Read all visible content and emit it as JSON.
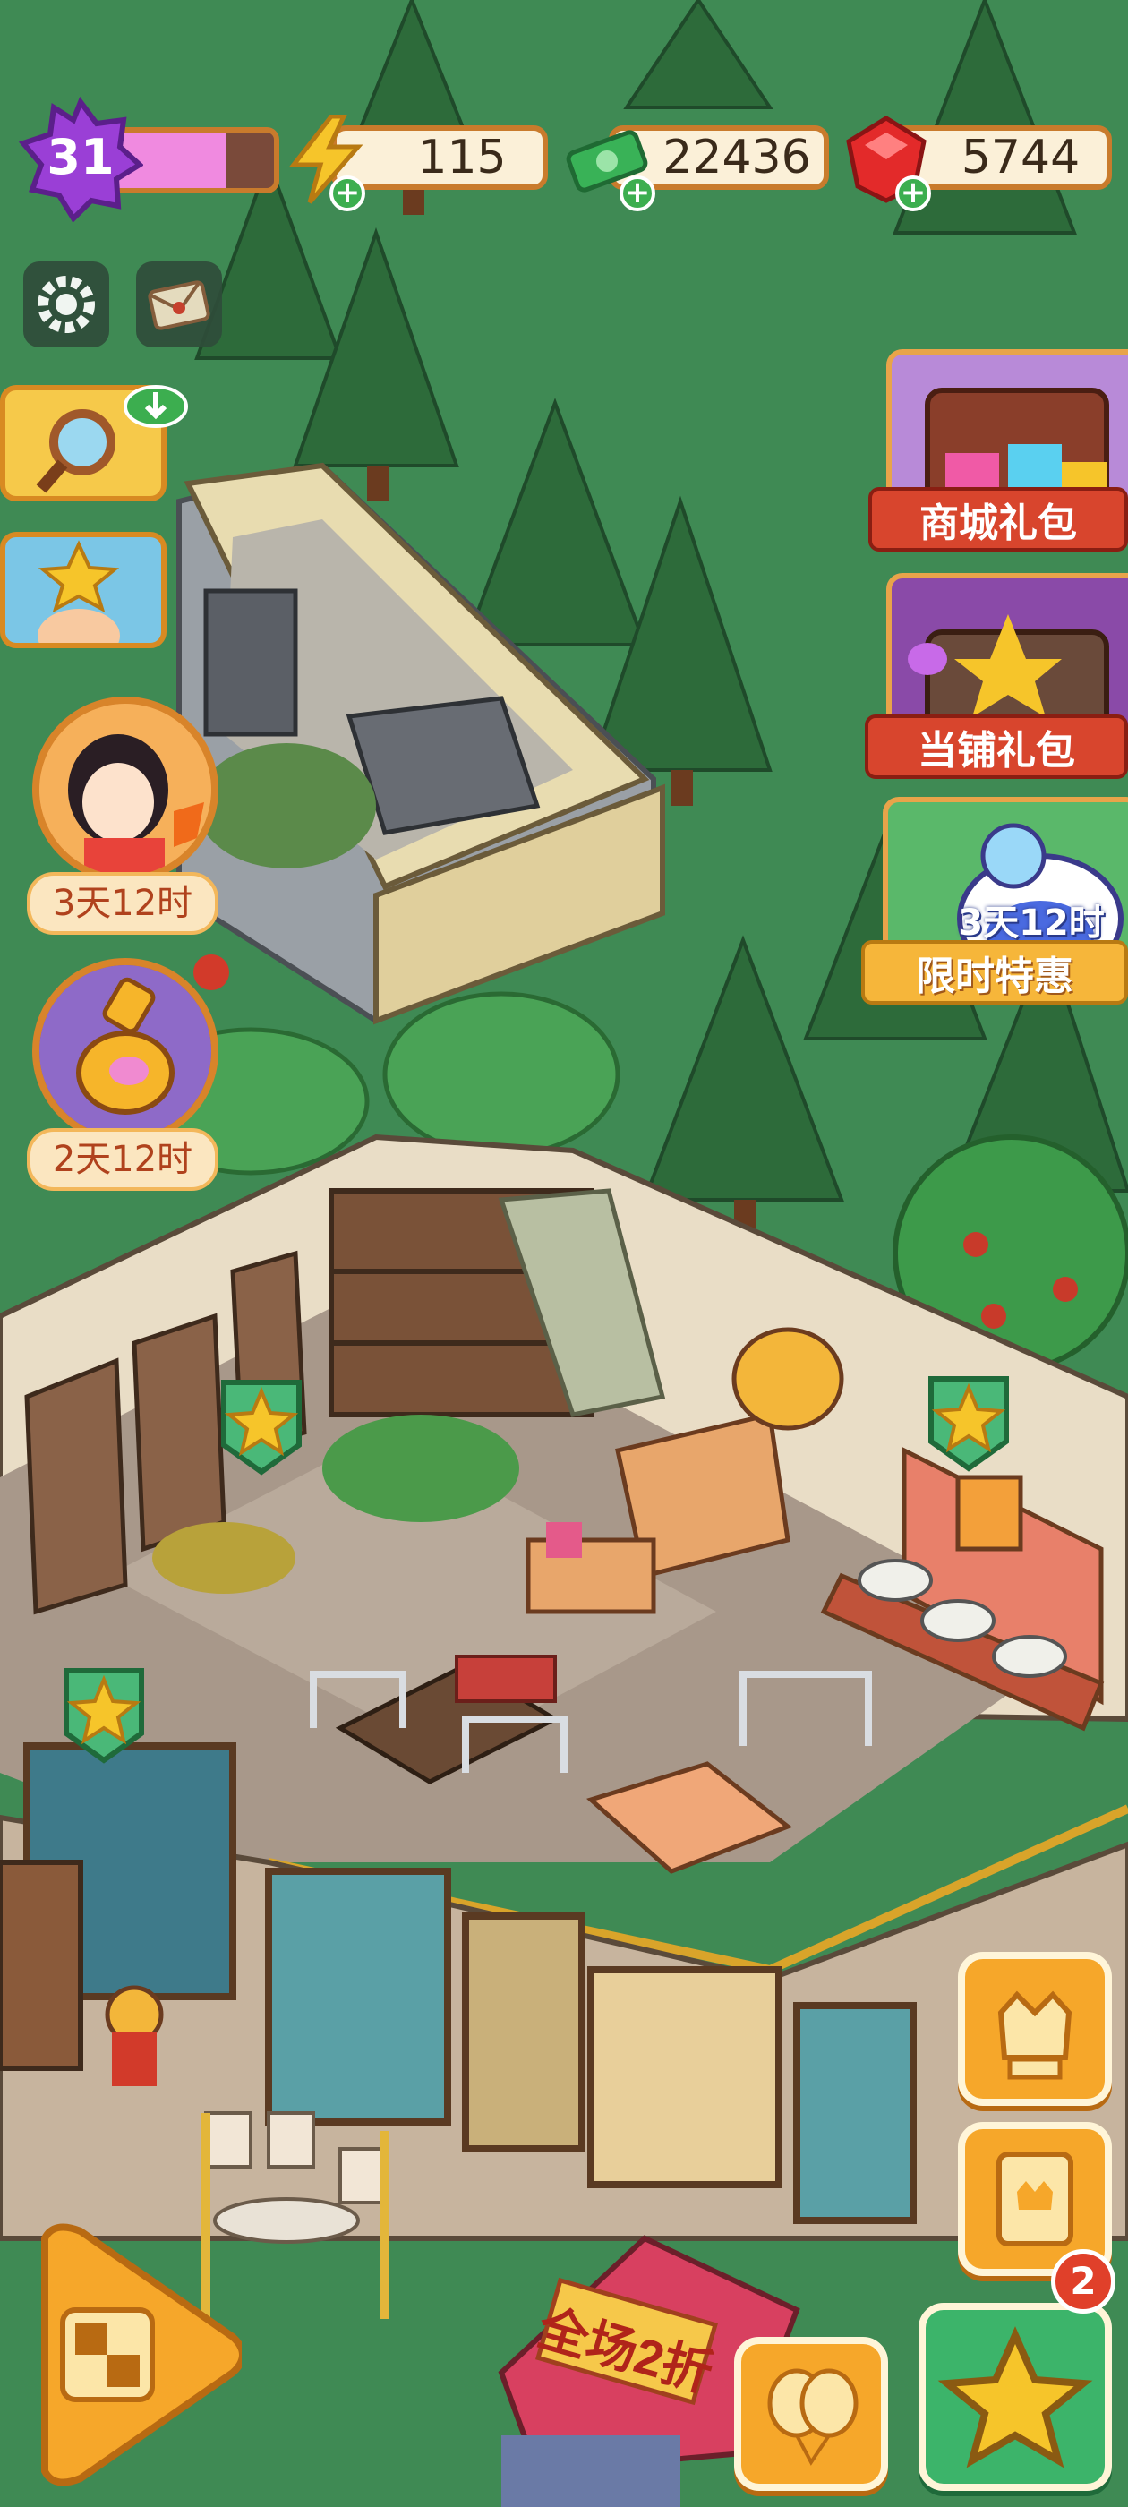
{
  "hud": {
    "level": "31",
    "level_progress": 0.7,
    "energy": "115",
    "cash": "22436",
    "gems": "5744"
  },
  "left_timers": {
    "character_event": "3天12时",
    "potion_event": "2天12时"
  },
  "right_offers": {
    "shop_pack": "商城礼包",
    "pawn_pack": "当铺礼包",
    "limited_timer": "3天12时",
    "limited_offer": "限时特惠"
  },
  "store_banner": "全场2折",
  "bottom": {
    "star_badge_count": "2"
  },
  "colors": {
    "grass": "#3f8a54",
    "hud_border": "#c97b2c",
    "offer_red": "#d8452d",
    "offer_yellow": "#f6b63a",
    "button_orange": "#f6a72a",
    "button_green": "#3cb46a"
  },
  "icons": [
    "level-star-icon",
    "energy-bolt-icon",
    "cash-stack-icon",
    "ruby-gem-icon",
    "settings-gear-icon",
    "mail-envelope-icon",
    "magnifier-icon",
    "download-cloud-icon",
    "star-character-icon",
    "character-portrait-icon",
    "potion-icon",
    "task-star-icon",
    "puzzle-icon",
    "balloon-icon",
    "crown-book-icon",
    "crown-cat-icon",
    "favorite-star-icon"
  ]
}
